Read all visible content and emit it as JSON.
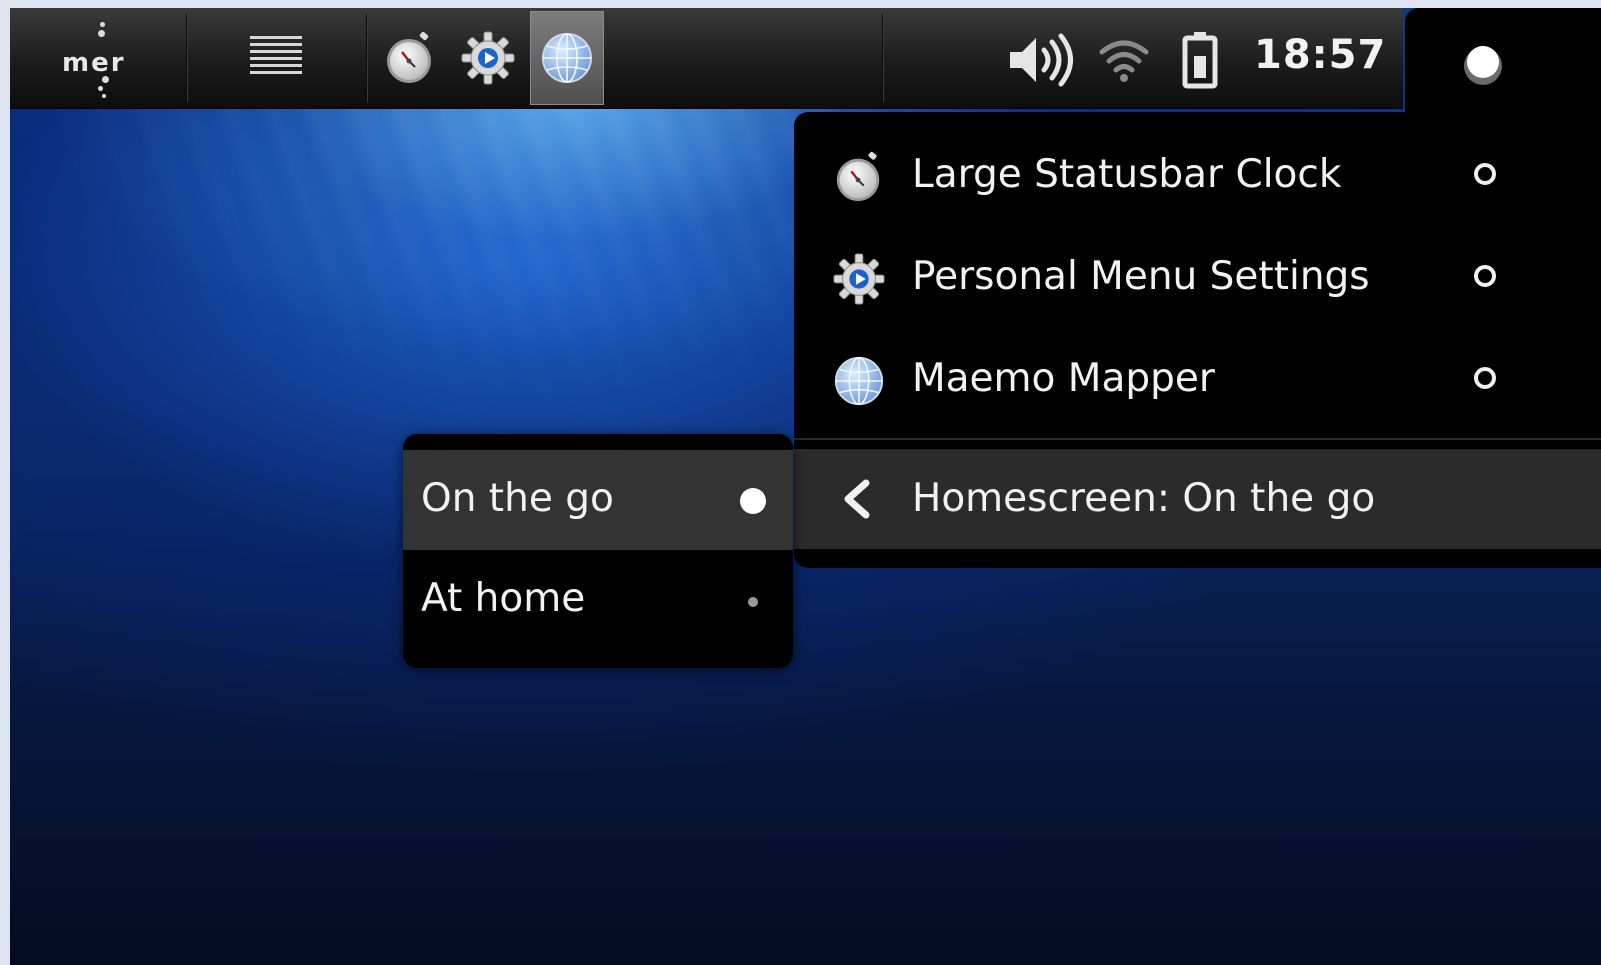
{
  "statusbar": {
    "logo_text": "mer",
    "clock": "18:57",
    "icons": {
      "logo": "mer-logo",
      "launcher": "list-icon",
      "app1": "stopwatch-clock-icon",
      "app2": "gear-settings-icon",
      "app3": "globe-icon",
      "volume": "volume-icon",
      "wifi": "wifi-icon",
      "battery": "battery-icon",
      "menu_toggle": "record-dot-icon"
    }
  },
  "menu": {
    "items": [
      {
        "label": "Large Statusbar Clock",
        "icon": "stopwatch-clock-icon",
        "selected": false
      },
      {
        "label": "Personal Menu Settings",
        "icon": "gear-settings-icon",
        "selected": false
      },
      {
        "label": "Maemo Mapper",
        "icon": "globe-icon",
        "selected": false
      }
    ],
    "homescreen": {
      "label": "Homescreen: On the go",
      "icon": "chevron-left-icon"
    }
  },
  "submenu": {
    "items": [
      {
        "label": "On the go",
        "selected": true
      },
      {
        "label": "At home",
        "selected": false
      }
    ]
  },
  "colors": {
    "panel_bg": "#000000",
    "highlight_row": "#2b2b2b",
    "text": "#f2f2f2"
  }
}
